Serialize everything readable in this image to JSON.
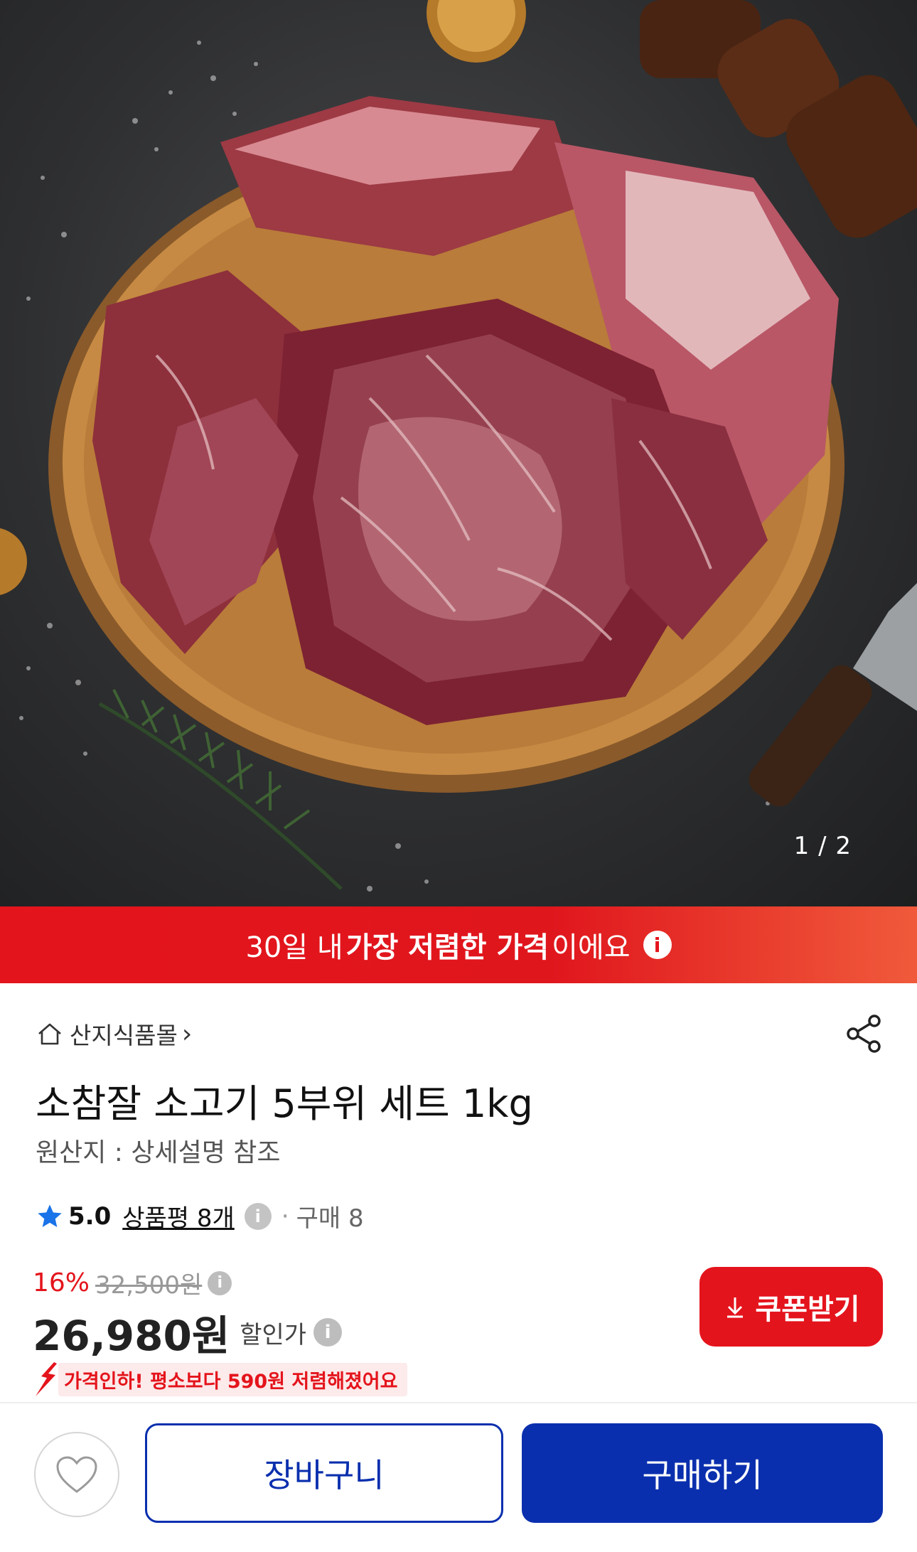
{
  "gallery": {
    "counter": "1 / 2"
  },
  "banner": {
    "prefix": "30일 내 ",
    "bold": "가장 저렴한 가격",
    "suffix": "이에요",
    "info_glyph": "i"
  },
  "store": {
    "name": "산지식품몰",
    "chevron": "›",
    "icon": "home-icon"
  },
  "share_icon": "share-icon",
  "product": {
    "title": "소참잘 소고기 5부위 세트 1kg",
    "origin": "원산지 : 상세설명 참조"
  },
  "rating": {
    "score": "5.0",
    "reviews": "상품평 8개",
    "info_glyph": "i",
    "dot": "·",
    "purchases": "구매 8",
    "icon": "star-icon"
  },
  "price": {
    "discount_pct": "16%",
    "original": "32,500원",
    "info_glyph": "i",
    "amount": "26,980원",
    "label": "할인가",
    "coupon_label": "쿠폰받기",
    "drop_message": "가격인하! 평소보다 590원 저렴해졌어요"
  },
  "actions": {
    "cart_label": "장바구니",
    "buy_label": "구매하기"
  },
  "colors": {
    "accent_red": "#e4141c",
    "brand_blue": "#0a2fae"
  }
}
